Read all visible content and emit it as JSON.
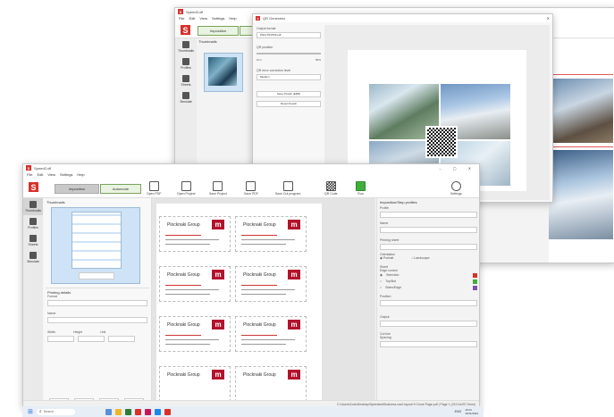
{
  "back_window": {
    "app_title": "SpeedCuff",
    "menu": [
      "File",
      "Edit",
      "View",
      "Settings",
      "Help"
    ],
    "imposition_label": "Imposition",
    "side_items": [
      "Thumbnails",
      "Profiles",
      "Sheets",
      "Simulate"
    ],
    "thumbnails_label": "Thumbnails"
  },
  "qr_dialog": {
    "title": "QR Generator",
    "output_format_label": "Output format",
    "output_format_value": "PNG/TIF/PDF.pdf",
    "qr_position_label": "QR position",
    "qr_size_label": "QR size",
    "qr_size_value": "89%",
    "x_value": "10.1",
    "ec_label": "QR error correction level",
    "ec_value": "Medium",
    "save_button": "Save Pyrash (ERR)",
    "reset_button": "Reset Pyrash"
  },
  "front_window": {
    "app_title": "SpeedCuff",
    "menu": [
      "File",
      "Edit",
      "View",
      "Settings",
      "Help"
    ],
    "modes": [
      "Imposition",
      "Automode"
    ],
    "toolbar": [
      "Open PDF",
      "Open Project",
      "Save Project",
      "Save PDF",
      "Save Cut program",
      "QR Code",
      "Run",
      "Settings"
    ],
    "side_items": [
      "Thumbnails",
      "Profiles",
      "Sheets",
      "Simulate"
    ],
    "thumbnails_label": "Thumbnails",
    "printing_details_label": "Printing details",
    "detail_fields": [
      "Format",
      "Name",
      "Width",
      "Height",
      "Unit"
    ],
    "detail_buttons": [
      "New",
      "Edit",
      "Delete",
      "Cancel"
    ],
    "right_panel_title": "Imposition/Step profiles",
    "right_sections": [
      "Profile",
      "Name",
      "Printing sheet",
      "Orientation",
      "Sheet",
      "Edge control",
      "Position",
      "Output",
      "Cut line",
      "Spacing"
    ],
    "orientation_options": [
      "Portrait",
      "Landscape"
    ],
    "edge_options": [
      "Selection",
      "Top/Bot",
      "Sides/Edge"
    ],
    "brand_text": "Plocknaki Group",
    "logo_letter": "m",
    "status_path": "C:\\Users\\Cuts\\Desktop\\Speedcut\\Business card layout 9 Clone Page.pdf | Page 1 (210.0x297.0mm)"
  },
  "taskbar": {
    "search_placeholder": "Search",
    "tray_lang": "ENG",
    "tray_time": "10:24",
    "tray_date": "19/11/2024"
  },
  "colors": {
    "logo_red": "#d9302a",
    "brand_red": "#b3122b",
    "accent_green": "#7aa45e",
    "run_green": "#3fae3c",
    "thumb_blue": "#cfe3f6"
  },
  "icons": [
    "speedcuff-logo-icon",
    "open-pdf-icon",
    "open-project-icon",
    "save-project-icon",
    "save-pdf-icon",
    "save-cut-icon",
    "qr-code-icon",
    "run-icon",
    "settings-icon",
    "windows-start-icon",
    "search-icon"
  ]
}
